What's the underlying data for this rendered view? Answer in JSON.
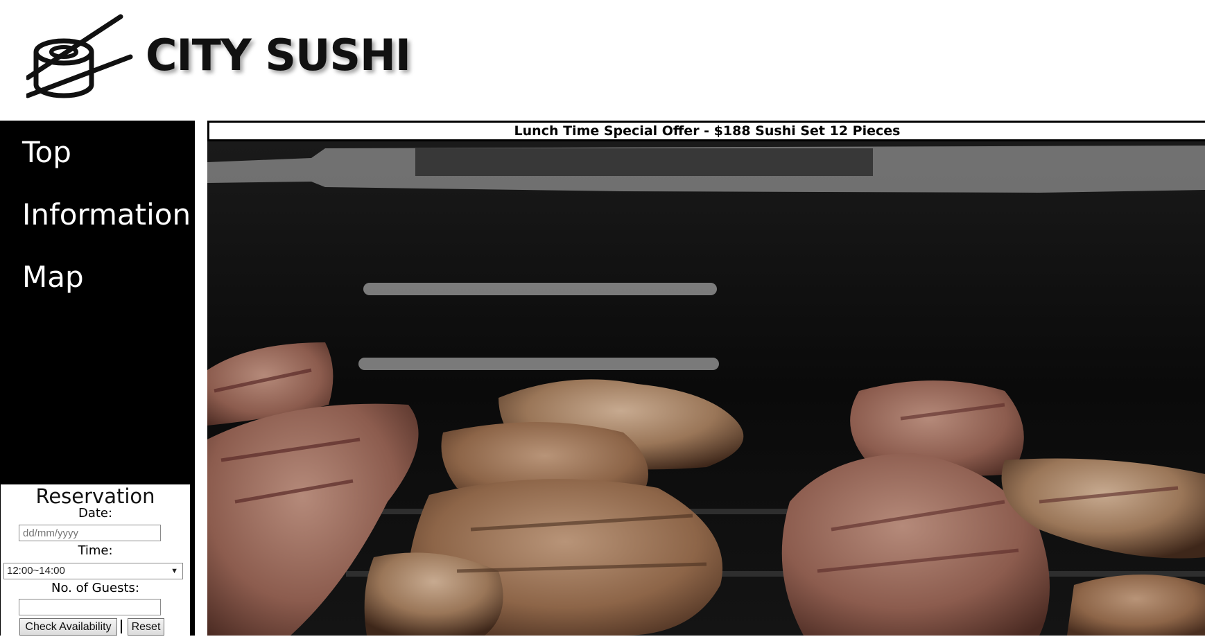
{
  "brand": {
    "logo_icon": "sushi-chopsticks-icon",
    "name": "CITY SUSHI"
  },
  "nav": {
    "items": [
      {
        "label": "Top"
      },
      {
        "label": "Information"
      },
      {
        "label": "Map"
      }
    ]
  },
  "reservation": {
    "title": "Reservation",
    "date_label": "Date:",
    "date_placeholder": "dd/mm/yyyy",
    "time_label": "Time:",
    "time_selected": "12:00~14:00",
    "guests_label": "No. of Guests:",
    "guests_value": "",
    "check_button": "Check Availability",
    "reset_button": "Reset"
  },
  "main": {
    "banner": "Lunch Time Special Offer - $188 Sushi Set 12 Pieces",
    "photo_subject": "grilled-meat-photo"
  },
  "colors": {
    "sidebar_bg": "#000000",
    "nav_text": "#ffffff",
    "page_bg": "#ffffff"
  }
}
